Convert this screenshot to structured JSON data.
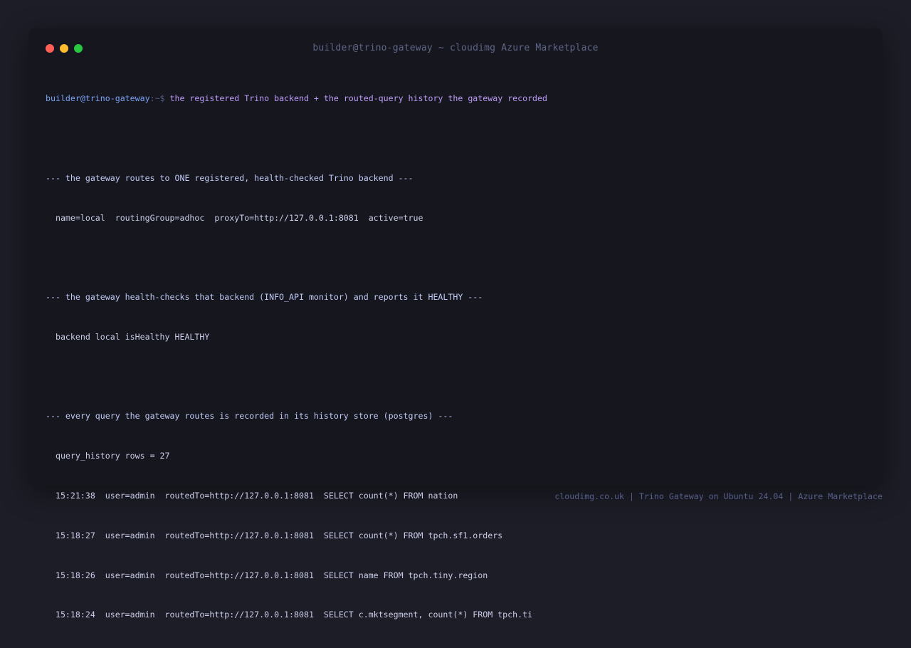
{
  "window": {
    "title": "builder@trino-gateway ~ cloudimg Azure Marketplace"
  },
  "prompt": {
    "user_host": "builder@trino-gateway",
    "path": ":~$ ",
    "command": "the registered Trino backend + the routed-query history the gateway recorded"
  },
  "output": {
    "section1_header": "--- the gateway routes to ONE registered, health-checked Trino backend ---",
    "section1_line": "  name=local  routingGroup=adhoc  proxyTo=http://127.0.0.1:8081  active=true",
    "section2_header": "--- the gateway health-checks that backend (INFO_API monitor) and reports it HEALTHY ---",
    "section2_line": "  backend local isHealthy HEALTHY",
    "section3_header": "--- every query the gateway routes is recorded in its history store (postgres) ---",
    "section3_rows": "  query_history rows = 27",
    "history": [
      "  15:21:38  user=admin  routedTo=http://127.0.0.1:8081  SELECT count(*) FROM nation",
      "  15:18:27  user=admin  routedTo=http://127.0.0.1:8081  SELECT count(*) FROM tpch.sf1.orders",
      "  15:18:26  user=admin  routedTo=http://127.0.0.1:8081  SELECT name FROM tpch.tiny.region",
      "  15:18:24  user=admin  routedTo=http://127.0.0.1:8081  SELECT c.mktsegment, count(*) FROM tpch.ti"
    ]
  },
  "footer": {
    "text": "cloudimg.co.uk | Trino Gateway on Ubuntu 24.04 | Azure Marketplace"
  },
  "colors": {
    "close": "#ff5f57",
    "minimize": "#febc2e",
    "maximize": "#28c840",
    "prompt_user": "#7aa2f7",
    "prompt_command": "#bb9af7"
  }
}
